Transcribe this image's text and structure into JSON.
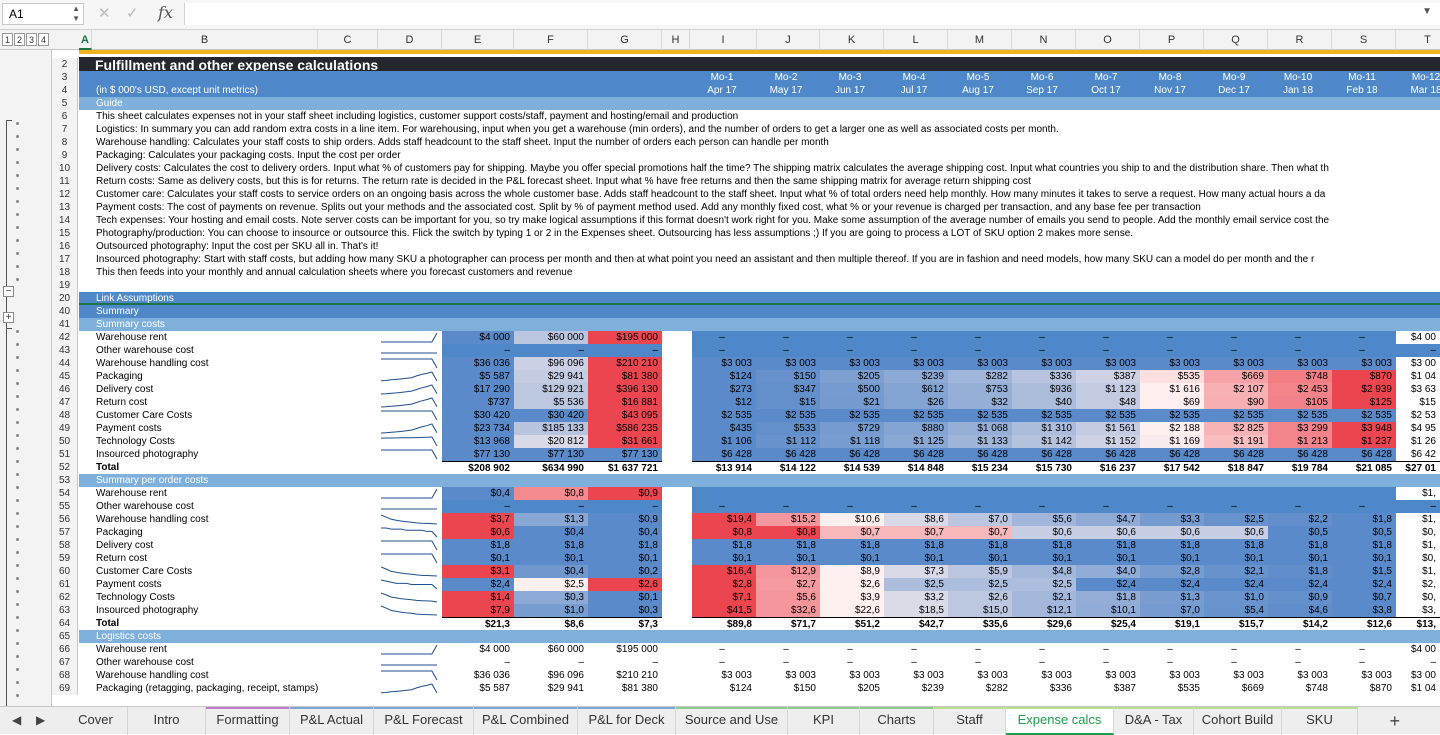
{
  "formula_bar": {
    "name_box": "A1",
    "cancel_icon": "✕",
    "confirm_icon": "✓",
    "fx_label": "fx",
    "formula": ""
  },
  "outline_levels": [
    "1",
    "2",
    "3",
    "4"
  ],
  "columns": [
    {
      "l": "A",
      "sel": true
    },
    {
      "l": "B"
    },
    {
      "l": "C"
    },
    {
      "l": "D"
    },
    {
      "l": "E"
    },
    {
      "l": "F"
    },
    {
      "l": "G"
    },
    {
      "l": "H"
    },
    {
      "l": "I"
    },
    {
      "l": "J"
    },
    {
      "l": "K"
    },
    {
      "l": "L"
    },
    {
      "l": "M"
    },
    {
      "l": "N"
    },
    {
      "l": "O"
    },
    {
      "l": "P"
    },
    {
      "l": "Q"
    },
    {
      "l": "R"
    },
    {
      "l": "S"
    },
    {
      "l": "T"
    }
  ],
  "title": "Fulfillment and other expense calculations",
  "units_note": "(in $ 000's USD, except unit metrics)",
  "guide_label": "Guide",
  "months": [
    "Mo-1",
    "Mo-2",
    "Mo-3",
    "Mo-4",
    "Mo-5",
    "Mo-6",
    "Mo-7",
    "Mo-8",
    "Mo-9",
    "Mo-10",
    "Mo-11",
    "Mo-12"
  ],
  "dates": [
    "Apr 17",
    "May 17",
    "Jun 17",
    "Jul 17",
    "Aug 17",
    "Sep 17",
    "Oct 17",
    "Nov 17",
    "Dec 17",
    "Jan 18",
    "Feb 18",
    "Mar 18"
  ],
  "guide_lines": [
    "This sheet calculates expenses not in your staff sheet including logistics, customer support costs/staff, payment and hosting/email and production",
    "Logistics: In summary you can add random extra costs in a line item. For warehousing, input when you get a warehouse (min orders), and the number of orders to get a larger one as well as associated costs per month.",
    "Warehouse handling: Calculates your staff costs to ship orders. Adds staff headcount to the staff sheet. Input the number of orders each person can handle per month",
    "Packaging: Calculates your packaging costs. Input the cost per order",
    "Delivery costs: Calculates the cost to delivery orders. Input what % of customers pay for shipping. Maybe you offer special promotions half the time? The shipping matrix calculates the average shipping cost. Input what countries you ship to and the distribution share. Then what th",
    "Return costs: Same as delivery costs, but this is for returns. The return rate is decided in the P&L forecast sheet. Input what % have free returns and then the same shipping matrix for average return shipping cost",
    "Customer care: Calculates your staff costs to service orders on an ongoing basis across the whole customer base. Adds staff headcount to the staff sheet. Input what % of total orders need help monthly. How many minutes it takes to serve a request. How many actual hours a da",
    "Payment costs: The cost of payments on revenue. Splits out your methods and the associated cost. Split by % of payment method used. Add any monthly fixed cost, what % or your revenue is charged per transaction, and any base fee per transaction",
    "Tech expenses: Your hosting and email costs. Note server costs can be important for you, so try make logical assumptions if this format doesn't work right for you. Make some assumption of the average number of emails you send to people. Add the monthly email service cost the",
    "Photography/production: You can choose to insource or outsource this. Flick the switch by typing 1 or 2 in the Expenses sheet. Outsourcing has less assumptions ;) If you are going to process a LOT of SKU option 2 makes more sense.",
    "Outsourced photography: Input the cost per SKU all in. That's it!",
    "Insourced photography: Start with staff costs, but adding how many SKU a photographer can process per month and then at what point you need an assistant and then multiple thereof. If you are in fashion and need models, how many SKU can a model do per month and the r",
    "This then feeds into your monthly and annual calculation sheets where you forecast customers and revenue"
  ],
  "section_labels": {
    "link": "Link Assumptions",
    "summary": "Summary",
    "summary_costs": "Summary costs",
    "per_order": "Summary per order costs",
    "logistics": "Logistics costs"
  },
  "summary_costs": [
    {
      "label": "Warehouse rent",
      "y": [
        "$4 000",
        "$60 000",
        "$195 000"
      ],
      "m": [
        "–",
        "–",
        "–",
        "–",
        "–",
        "–",
        "–",
        "–",
        "–",
        "–",
        "–"
      ],
      "last": "$4 00"
    },
    {
      "label": "Other warehouse cost",
      "y": [
        "–",
        "–",
        "–"
      ],
      "m": [
        "–",
        "–",
        "–",
        "–",
        "–",
        "–",
        "–",
        "–",
        "–",
        "–",
        "–"
      ],
      "last": "–"
    },
    {
      "label": "Warehouse handling cost",
      "y": [
        "$36 036",
        "$96 096",
        "$210 210"
      ],
      "m": [
        "$3 003",
        "$3 003",
        "$3 003",
        "$3 003",
        "$3 003",
        "$3 003",
        "$3 003",
        "$3 003",
        "$3 003",
        "$3 003",
        "$3 003"
      ],
      "last": "$3 00"
    },
    {
      "label": "Packaging",
      "y": [
        "$5 587",
        "$29 941",
        "$81 380"
      ],
      "m": [
        "$124",
        "$150",
        "$205",
        "$239",
        "$282",
        "$336",
        "$387",
        "$535",
        "$669",
        "$748",
        "$870"
      ],
      "last": "$1 04"
    },
    {
      "label": "Delivery cost",
      "y": [
        "$17 290",
        "$129 921",
        "$396 130"
      ],
      "m": [
        "$273",
        "$347",
        "$500",
        "$612",
        "$753",
        "$936",
        "$1 123",
        "$1 616",
        "$2 107",
        "$2 453",
        "$2 939"
      ],
      "last": "$3 63"
    },
    {
      "label": "Return cost",
      "y": [
        "$737",
        "$5 536",
        "$16 881"
      ],
      "m": [
        "$12",
        "$15",
        "$21",
        "$26",
        "$32",
        "$40",
        "$48",
        "$69",
        "$90",
        "$105",
        "$125"
      ],
      "last": "$15"
    },
    {
      "label": "Customer Care Costs",
      "y": [
        "$30 420",
        "$30 420",
        "$43 095"
      ],
      "m": [
        "$2 535",
        "$2 535",
        "$2 535",
        "$2 535",
        "$2 535",
        "$2 535",
        "$2 535",
        "$2 535",
        "$2 535",
        "$2 535",
        "$2 535"
      ],
      "last": "$2 53"
    },
    {
      "label": "Payment costs",
      "y": [
        "$23 734",
        "$185 133",
        "$586 235"
      ],
      "m": [
        "$435",
        "$533",
        "$729",
        "$880",
        "$1 068",
        "$1 310",
        "$1 561",
        "$2 188",
        "$2 825",
        "$3 299",
        "$3 948"
      ],
      "last": "$4 95"
    },
    {
      "label": "Technology Costs",
      "y": [
        "$13 968",
        "$20 812",
        "$31 661"
      ],
      "m": [
        "$1 106",
        "$1 112",
        "$1 118",
        "$1 125",
        "$1 133",
        "$1 142",
        "$1 152",
        "$1 169",
        "$1 191",
        "$1 213",
        "$1 237"
      ],
      "last": "$1 26"
    },
    {
      "label": "Insourced photography",
      "y": [
        "$77 130",
        "$77 130",
        "$77 130"
      ],
      "m": [
        "$6 428",
        "$6 428",
        "$6 428",
        "$6 428",
        "$6 428",
        "$6 428",
        "$6 428",
        "$6 428",
        "$6 428",
        "$6 428",
        "$6 428"
      ],
      "last": "$6 42"
    },
    {
      "label": "Total",
      "bold": true,
      "y": [
        "$208 902",
        "$634 990",
        "$1 637 721"
      ],
      "m": [
        "$13 914",
        "$14 122",
        "$14 539",
        "$14 848",
        "$15 234",
        "$15 730",
        "$16 237",
        "$17 542",
        "$18 847",
        "$19 784",
        "$21 085"
      ],
      "last": "$27 01"
    }
  ],
  "per_order_costs": [
    {
      "label": "Warehouse rent",
      "y": [
        "$0,4",
        "$0,8",
        "$0,9"
      ],
      "m": [
        "",
        "",
        "",
        "",
        "",
        "",
        "",
        "",
        "",
        "",
        ""
      ],
      "last": "$1,"
    },
    {
      "label": "Other warehouse cost",
      "y": [
        "–",
        "–",
        "–"
      ],
      "m": [
        "–",
        "–",
        "–",
        "–",
        "–",
        "–",
        "–",
        "–",
        "–",
        "–",
        "–"
      ],
      "last": "–"
    },
    {
      "label": "Warehouse handling cost",
      "y": [
        "$3,7",
        "$1,3",
        "$0,9"
      ],
      "m": [
        "$19,4",
        "$15,2",
        "$10,6",
        "$8,6",
        "$7,0",
        "$5,6",
        "$4,7",
        "$3,3",
        "$2,5",
        "$2,2",
        "$1,8"
      ],
      "last": "$1,"
    },
    {
      "label": "Packaging",
      "y": [
        "$0,6",
        "$0,4",
        "$0,4"
      ],
      "m": [
        "$0,8",
        "$0,8",
        "$0,7",
        "$0,7",
        "$0,7",
        "$0,6",
        "$0,6",
        "$0,6",
        "$0,6",
        "$0,5",
        "$0,5"
      ],
      "last": "$0,"
    },
    {
      "label": "Delivery cost",
      "y": [
        "$1,8",
        "$1,8",
        "$1,8"
      ],
      "m": [
        "$1,8",
        "$1,8",
        "$1,8",
        "$1,8",
        "$1,8",
        "$1,8",
        "$1,8",
        "$1,8",
        "$1,8",
        "$1,8",
        "$1,8"
      ],
      "last": "$1,"
    },
    {
      "label": "Return cost",
      "y": [
        "$0,1",
        "$0,1",
        "$0,1"
      ],
      "m": [
        "$0,1",
        "$0,1",
        "$0,1",
        "$0,1",
        "$0,1",
        "$0,1",
        "$0,1",
        "$0,1",
        "$0,1",
        "$0,1",
        "$0,1"
      ],
      "last": "$0,"
    },
    {
      "label": "Customer Care Costs",
      "y": [
        "$3,1",
        "$0,4",
        "$0,2"
      ],
      "m": [
        "$16,4",
        "$12,9",
        "$8,9",
        "$7,3",
        "$5,9",
        "$4,8",
        "$4,0",
        "$2,8",
        "$2,1",
        "$1,8",
        "$1,5"
      ],
      "last": "$1,"
    },
    {
      "label": "Payment costs",
      "y": [
        "$2,4",
        "$2,5",
        "$2,6"
      ],
      "m": [
        "$2,8",
        "$2,7",
        "$2,6",
        "$2,5",
        "$2,5",
        "$2,5",
        "$2,4",
        "$2,4",
        "$2,4",
        "$2,4",
        "$2,4"
      ],
      "last": "$2,"
    },
    {
      "label": "Technology Costs",
      "y": [
        "$1,4",
        "$0,3",
        "$0,1"
      ],
      "m": [
        "$7,1",
        "$5,6",
        "$3,9",
        "$3,2",
        "$2,6",
        "$2,1",
        "$1,8",
        "$1,3",
        "$1,0",
        "$0,9",
        "$0,7"
      ],
      "last": "$0,"
    },
    {
      "label": "Insourced photography",
      "y": [
        "$7,9",
        "$1,0",
        "$0,3"
      ],
      "m": [
        "$41,5",
        "$32,6",
        "$22,6",
        "$18,5",
        "$15,0",
        "$12,1",
        "$10,1",
        "$7,0",
        "$5,4",
        "$4,6",
        "$3,8"
      ],
      "last": "$3,"
    },
    {
      "label": "Total",
      "bold": true,
      "y": [
        "$21,3",
        "$8,6",
        "$7,3"
      ],
      "m": [
        "$89,8",
        "$71,7",
        "$51,2",
        "$42,7",
        "$35,6",
        "$29,6",
        "$25,4",
        "$19,1",
        "$15,7",
        "$14,2",
        "$12,6"
      ],
      "last": "$13,"
    }
  ],
  "logistics_rows": [
    {
      "label": "Warehouse rent",
      "y": [
        "$4 000",
        "$60 000",
        "$195 000"
      ],
      "m": [
        "–",
        "–",
        "–",
        "–",
        "–",
        "–",
        "–",
        "–",
        "–",
        "–",
        "–"
      ],
      "last": "$4 00"
    },
    {
      "label": "Other warehouse cost",
      "y": [
        "–",
        "–",
        "–"
      ],
      "m": [
        "–",
        "–",
        "–",
        "–",
        "–",
        "–",
        "–",
        "–",
        "–",
        "–",
        "–"
      ],
      "last": "–"
    },
    {
      "label": "Warehouse handling cost",
      "y": [
        "$36 036",
        "$96 096",
        "$210 210"
      ],
      "m": [
        "$3 003",
        "$3 003",
        "$3 003",
        "$3 003",
        "$3 003",
        "$3 003",
        "$3 003",
        "$3 003",
        "$3 003",
        "$3 003",
        "$3 003"
      ],
      "last": "$3 00"
    },
    {
      "label": "Packaging (retagging, packaging, receipt, stamps)",
      "y": [
        "$5 587",
        "$29 941",
        "$81 380"
      ],
      "m": [
        "$124",
        "$150",
        "$205",
        "$239",
        "$282",
        "$336",
        "$387",
        "$535",
        "$669",
        "$748",
        "$870"
      ],
      "last": "$1 04"
    }
  ],
  "row_numbers": [
    "2",
    "3",
    "4",
    "5",
    "6",
    "7",
    "8",
    "9",
    "10",
    "11",
    "12",
    "13",
    "14",
    "15",
    "16",
    "17",
    "18",
    "19",
    "20",
    "40",
    "41",
    "42",
    "43",
    "44",
    "45",
    "46",
    "47",
    "48",
    "49",
    "50",
    "51",
    "52",
    "53",
    "54",
    "55",
    "56",
    "57",
    "58",
    "59",
    "60",
    "61",
    "62",
    "63",
    "64",
    "65",
    "66",
    "67",
    "68",
    "69"
  ],
  "sheet_tabs": [
    {
      "label": "Cover",
      "color": ""
    },
    {
      "label": "Intro",
      "color": ""
    },
    {
      "label": "Formatting",
      "color": "#c27ac7"
    },
    {
      "label": "P&L Actual",
      "color": "#7aa6d8"
    },
    {
      "label": "P&L Forecast",
      "color": "#7aa6d8"
    },
    {
      "label": "P&L Combined",
      "color": "#7aa6d8"
    },
    {
      "label": "P&L for Deck",
      "color": "#7aa6d8"
    },
    {
      "label": "Source and Use",
      "color": "#8ccc8c"
    },
    {
      "label": "KPI",
      "color": "#8ccc8c"
    },
    {
      "label": "Charts",
      "color": "#8ccc8c"
    },
    {
      "label": "Staff",
      "color": "#b8e08a"
    },
    {
      "label": "Expense calcs",
      "color": "#b8e08a",
      "active": true
    },
    {
      "label": "D&A - Tax",
      "color": "#b8e08a"
    },
    {
      "label": "Cohort Build",
      "color": "#b8e08a"
    },
    {
      "label": "SKU",
      "color": "#b8e08a"
    }
  ],
  "colors": {
    "header_blue": "#4e88c9",
    "sub_blue": "#7fb0dc",
    "title_dark": "#24282e",
    "accent_gold": "#f0b41c",
    "active_tab": "#1e9e4b"
  }
}
